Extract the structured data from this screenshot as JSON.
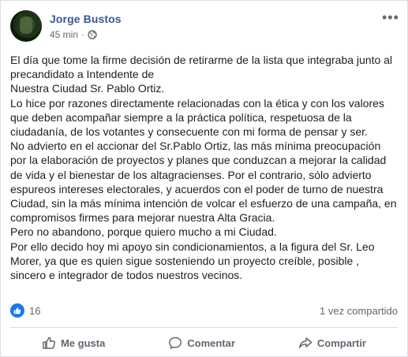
{
  "post": {
    "author": "Jorge Bustos",
    "time": "45 min",
    "separator": "·",
    "privacy_icon": "globe-icon",
    "more_icon": "more-options-icon",
    "paragraphs": [
      "El día que tome la firme decisión de retirarme de la lista que integraba junto al",
      "precandidato a Intendente de",
      "Nuestra Ciudad Sr. Pablo Ortiz.",
      "Lo hice por razones directamente relacionadas con la ética y con los valores",
      "que deben acompañar siempre a la práctica política, respetuosa de la",
      "ciudadanía, de los votantes y consecuente con mi forma de pensar y ser.",
      "No advierto en el accionar del Sr.Pablo Ortiz, las más mínima preocupación",
      "por la elaboración de proyectos y planes que conduzcan a mejorar la calidad",
      "de vida y el bienestar de los altagracienses. Por el contrario, sólo advierto",
      "espureos intereses electorales, y acuerdos con el poder de turno de nuestra",
      "Ciudad, sin la más mínima intención de volcar el esfuerzo de una campaña, en",
      "compromisos firmes para mejorar nuestra Alta Gracia.",
      "Pero no abandono, porque quiero mucho a mi Ciudad.",
      "Por ello decido hoy mi apoyo sin condicionamientos, a la figura del Sr. Leo",
      "Morer, ya que es quien sigue sosteniendo un proyecto creíble, posible ,",
      "sincero e integrador de todos nuestros vecinos."
    ]
  },
  "stats": {
    "likes": "16",
    "shares": "1 vez compartido"
  },
  "actions": {
    "like": "Me gusta",
    "comment": "Comentar",
    "share": "Compartir"
  },
  "colors": {
    "author": "#385898",
    "accent": "#1877f2",
    "text": "#1c1e21",
    "muted": "#606770"
  }
}
